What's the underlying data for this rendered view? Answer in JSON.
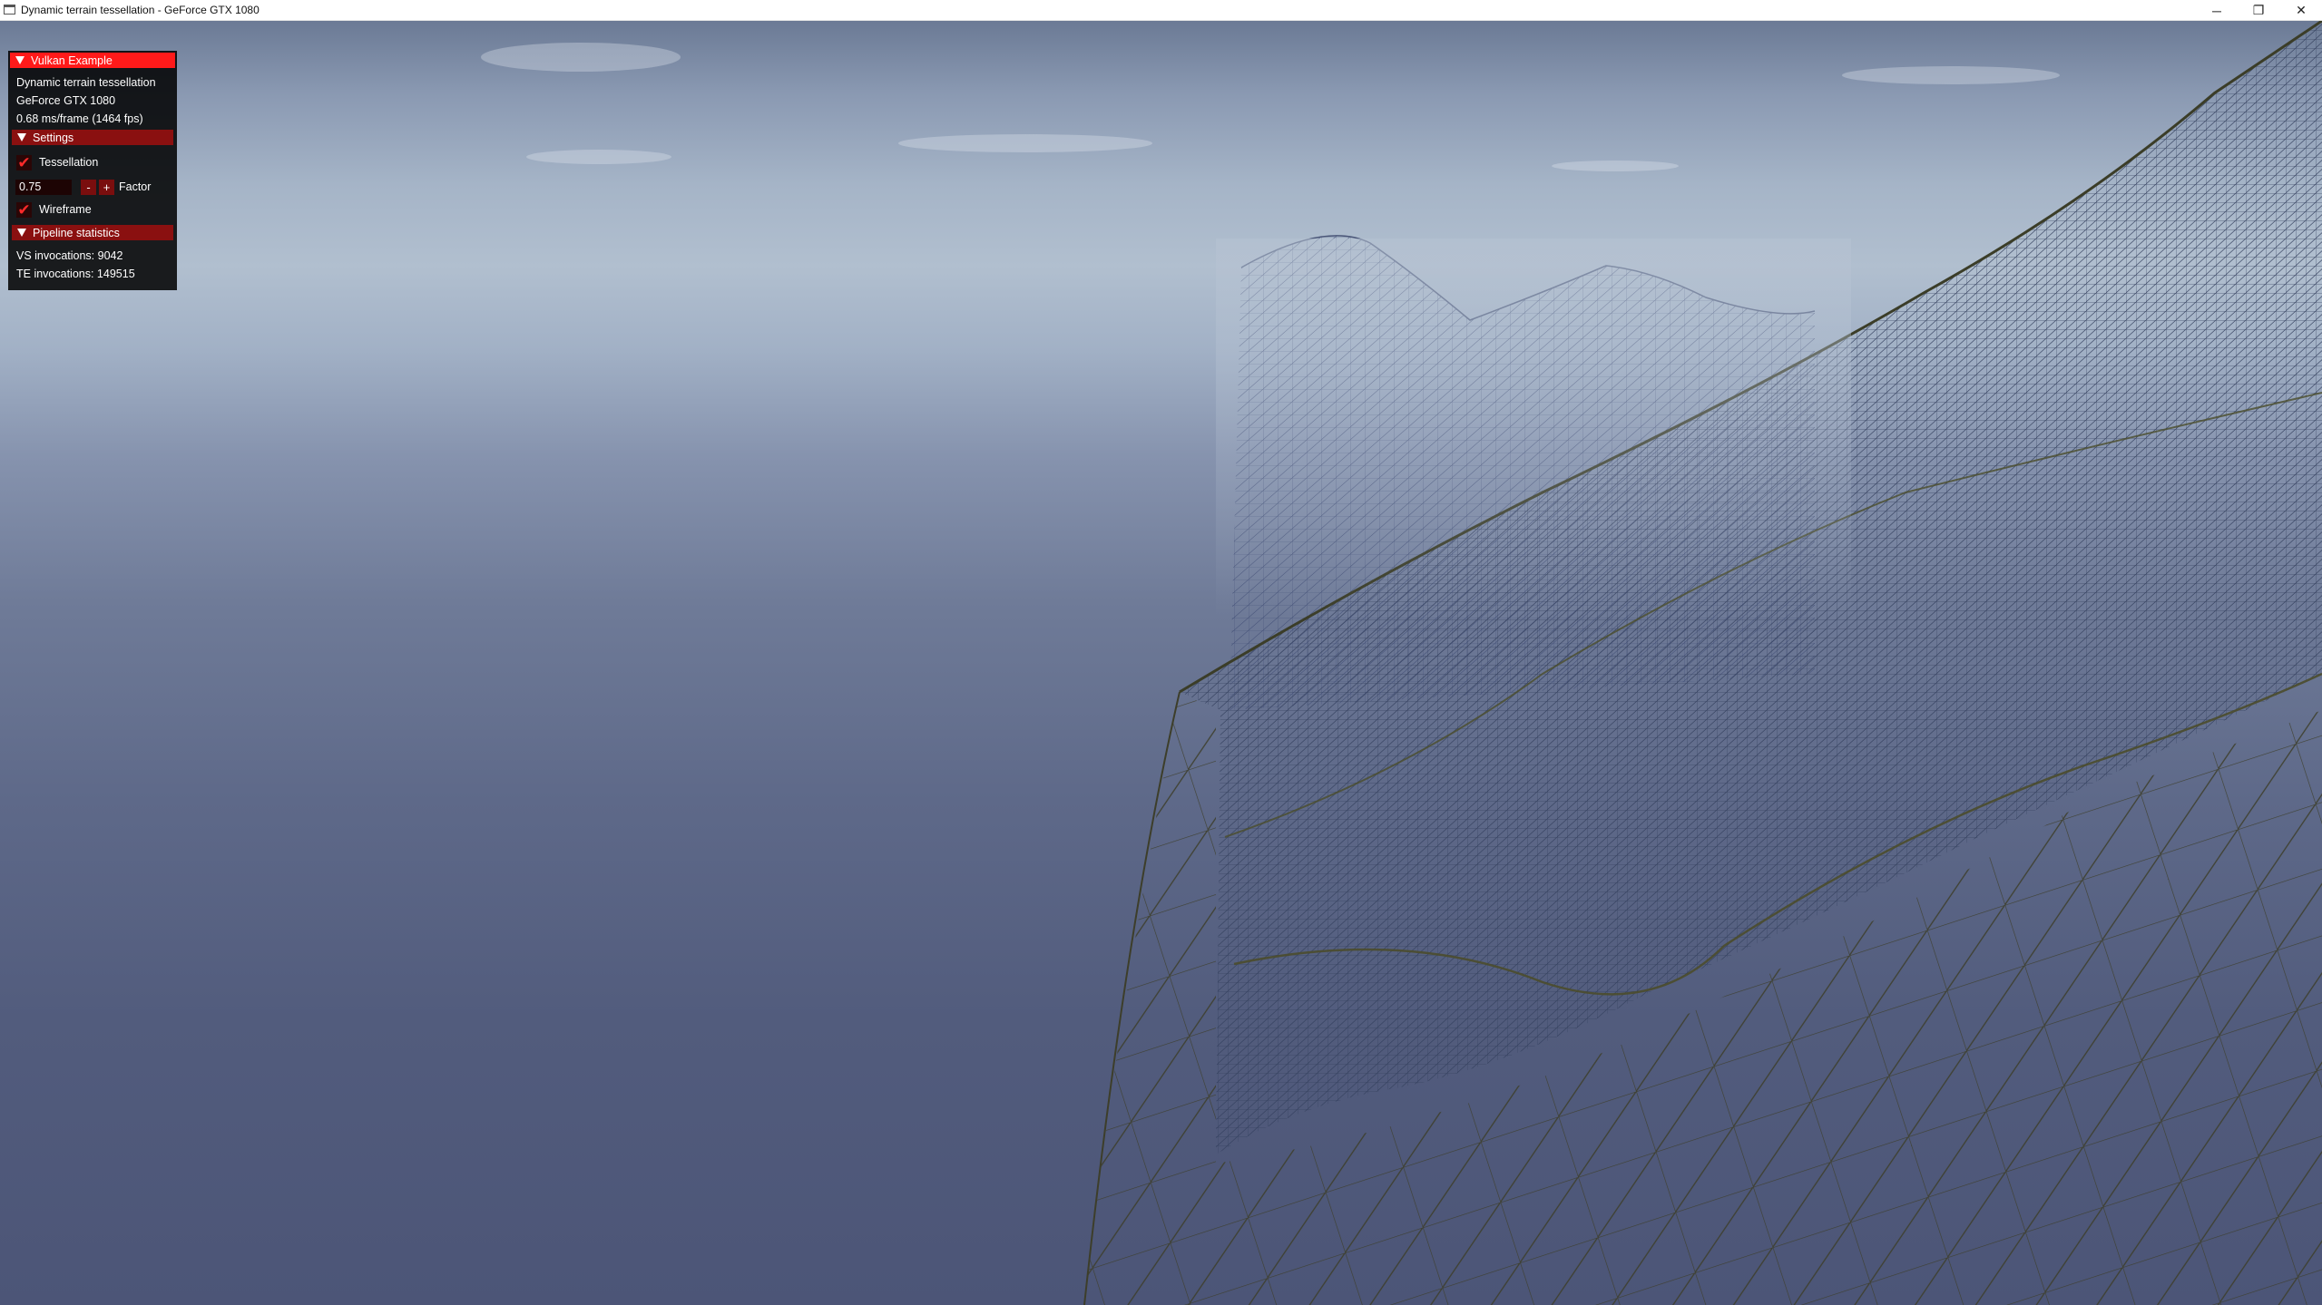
{
  "window": {
    "title": "Dynamic terrain tessellation - GeForce GTX 1080",
    "minimize_glyph": "─",
    "maximize_glyph": "❐",
    "close_glyph": "✕"
  },
  "overlay": {
    "header": "Vulkan Example",
    "app_name": "Dynamic terrain tessellation",
    "gpu": "GeForce GTX 1080",
    "frame_time": "0.68 ms/frame (1464 fps)",
    "settings": {
      "header": "Settings",
      "tessellation_label": "Tessellation",
      "tessellation_checked": true,
      "factor_value": "0.75",
      "minus_label": "-",
      "plus_label": "+",
      "factor_label": "Factor",
      "wireframe_label": "Wireframe",
      "wireframe_checked": true,
      "check_glyph": "✔"
    },
    "pipeline": {
      "header": "Pipeline statistics",
      "vs_invocations": "VS invocations: 9042",
      "te_invocations": "TE invocations: 149515"
    }
  },
  "colors": {
    "header_accent": "#ff1a1a",
    "section_header": "#8a1010",
    "wire_near": "#4a4a26",
    "wire_far": "#3f4c75"
  }
}
